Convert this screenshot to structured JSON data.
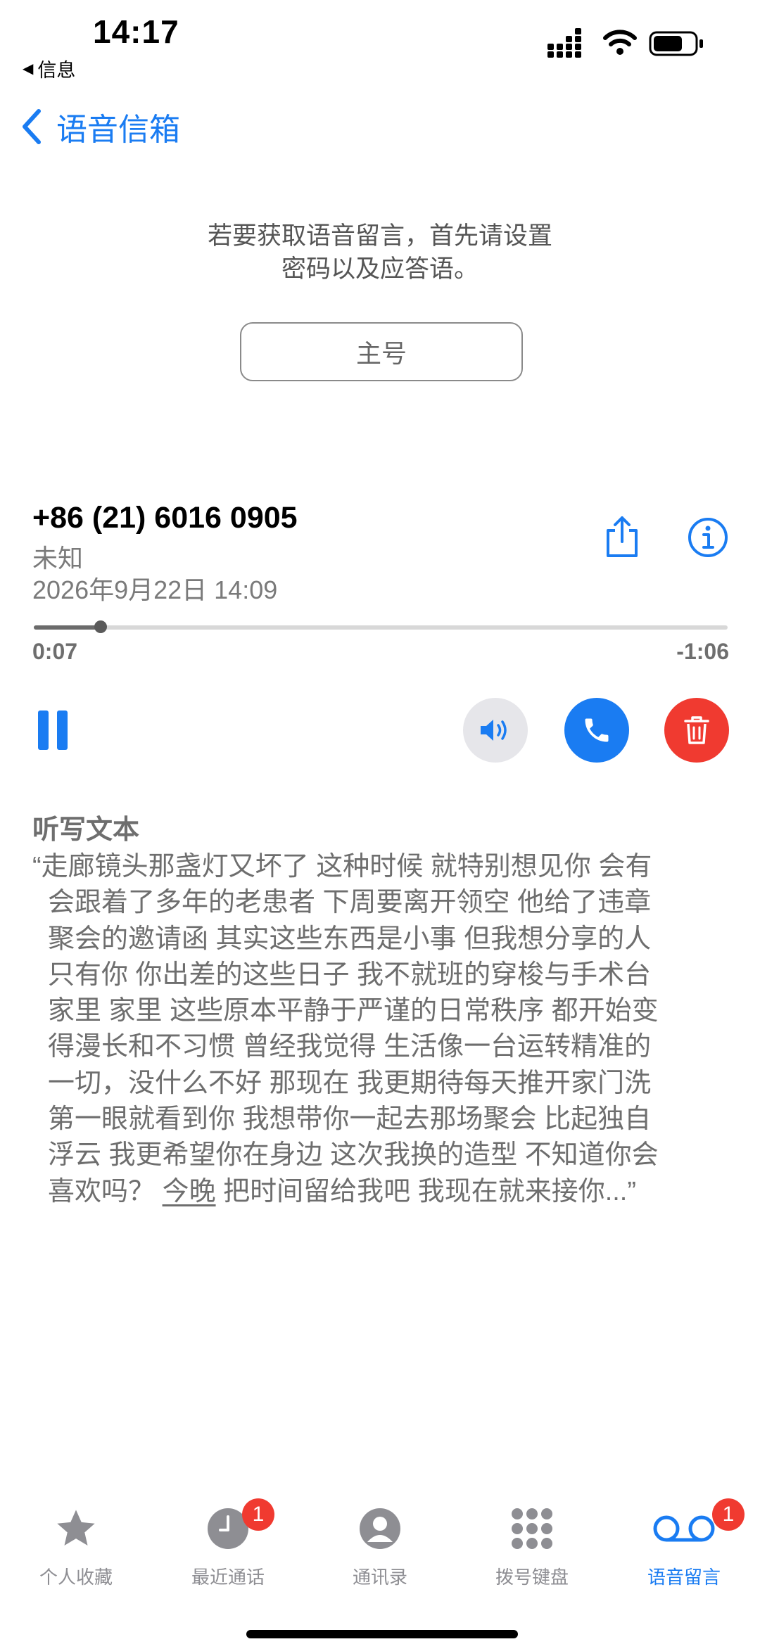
{
  "status_bar": {
    "time": "14:17",
    "back_app": "信息"
  },
  "nav": {
    "back_label": "语音信箱"
  },
  "setup": {
    "line1": "若要获取语音留言，首先请设置",
    "line2": "密码以及应答语。",
    "button_label": "主号"
  },
  "voicemail": {
    "phone": "+86 (21) 6016 0905",
    "caller": "未知",
    "date": "2026年9月22日 14:09",
    "elapsed": "0:07",
    "remaining": "-1:06",
    "progress_fraction": 0.096
  },
  "transcript": {
    "title": "听写文本",
    "lines": [
      "“走廊镜头那盏灯又坏了 这种时候 就特别想见你 会有",
      "会跟着了多年的老患者 下周要离开领空 他给了违章",
      "聚会的邀请函 其实这些东西是小事 但我想分享的人",
      "只有你 你出差的这些日子 我不就班的穿梭与手术台",
      "家里 家里 这些原本平静于严谨的日常秩序 都开始变",
      "得漫长和不习惯 曾经我觉得 生活像一台运转精准的",
      "一切，没什么不好 那现在 我更期待每天推开家门洗",
      "第一眼就看到你 我想带你一起去那场聚会 比起独自",
      "浮云 我更希望你在身边 这次我换的造型 不知道你会"
    ],
    "last_pre": "喜欢吗？ ",
    "last_link": "今晚",
    "last_post": " 把时间留给我吧 我现在就来接你...”"
  },
  "tabbar": {
    "favorites": "个人收藏",
    "recents": "最近通话",
    "recents_badge": "1",
    "contacts": "通讯录",
    "keypad": "拨号键盘",
    "voicemail": "语音留言",
    "voicemail_badge": "1"
  },
  "colors": {
    "accent": "#1a7cf2",
    "danger": "#f03a30",
    "secondary_text": "#6e6e6e"
  }
}
